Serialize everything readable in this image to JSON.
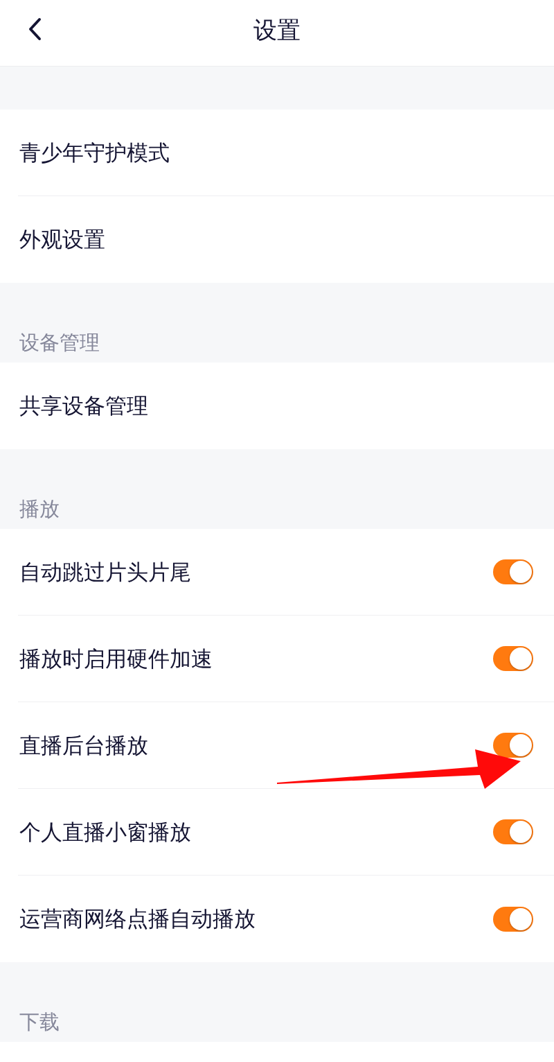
{
  "header": {
    "title": "设置"
  },
  "sections": [
    {
      "items": [
        {
          "kind": "link",
          "label": "青少年守护模式"
        },
        {
          "kind": "link",
          "label": "外观设置"
        }
      ]
    },
    {
      "title": "设备管理",
      "items": [
        {
          "kind": "link",
          "label": "共享设备管理"
        }
      ]
    },
    {
      "title": "播放",
      "items": [
        {
          "kind": "toggle",
          "label": "自动跳过片头片尾",
          "on": true
        },
        {
          "kind": "toggle",
          "label": "播放时启用硬件加速",
          "on": true
        },
        {
          "kind": "toggle",
          "label": "直播后台播放",
          "on": true
        },
        {
          "kind": "toggle",
          "label": "个人直播小窗播放",
          "on": true
        },
        {
          "kind": "toggle",
          "label": "运营商网络点播自动播放",
          "on": true
        }
      ]
    },
    {
      "title": "下载"
    }
  ]
}
